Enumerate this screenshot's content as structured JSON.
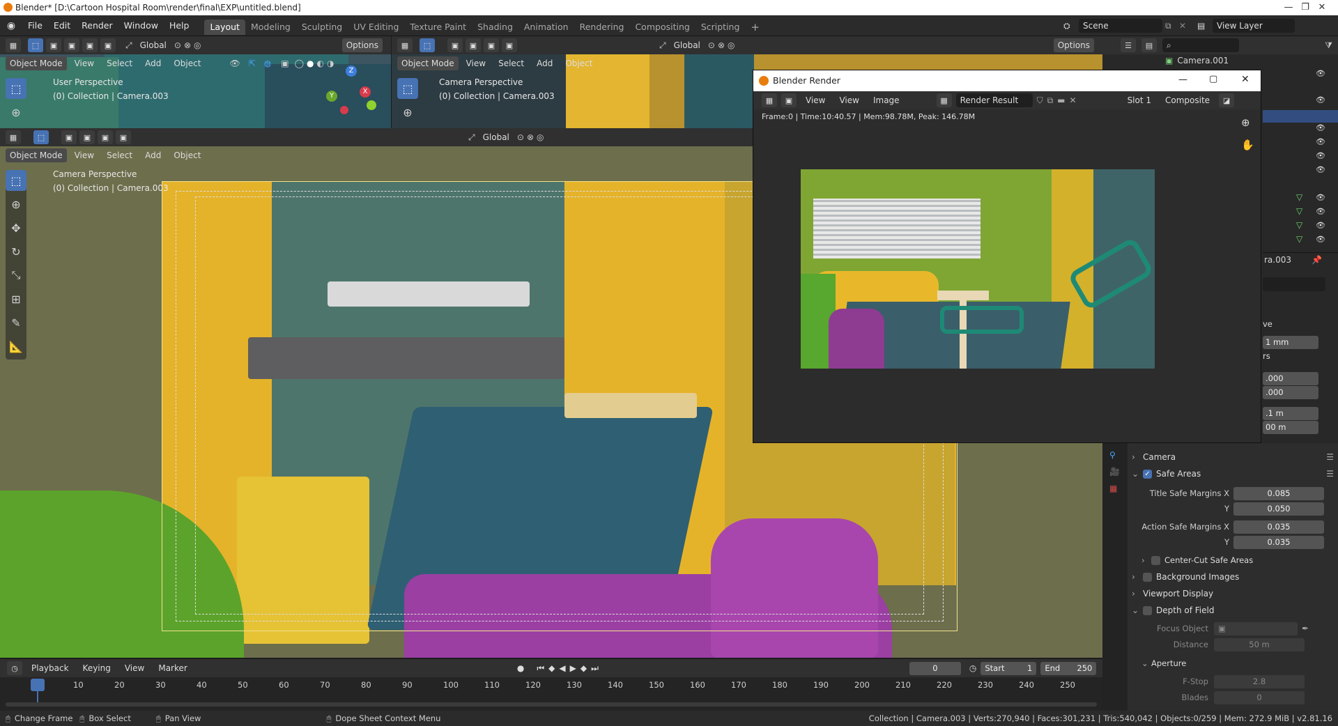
{
  "window": {
    "title": "Blender* [D:\\Cartoon Hospital Room\\render\\final\\EXP\\untitled.blend]",
    "minimize": "—",
    "maximize": "❐",
    "close": "✕"
  },
  "menu": [
    "File",
    "Edit",
    "Render",
    "Window",
    "Help"
  ],
  "workspaces": [
    "Layout",
    "Modeling",
    "Sculpting",
    "UV Editing",
    "Texture Paint",
    "Shading",
    "Animation",
    "Rendering",
    "Compositing",
    "Scripting"
  ],
  "workspace_add": "+",
  "scene": {
    "name": "Scene",
    "view_layer": "View Layer"
  },
  "toolbar": {
    "transform_orientation": "Global",
    "options": "Options"
  },
  "viewport_top_left": {
    "mode": "Object Mode",
    "menus": [
      "View",
      "Select",
      "Add",
      "Object"
    ],
    "perspective": "User Perspective",
    "collection": "(0) Collection | Camera.003",
    "gizmo": {
      "x": "X",
      "y": "Y",
      "z": "Z"
    }
  },
  "viewport_top_right": {
    "mode": "Object Mode",
    "menus": [
      "View",
      "Select",
      "Add",
      "Object"
    ],
    "perspective": "Camera Perspective",
    "collection": "(0) Collection | Camera.003"
  },
  "viewport_main": {
    "orientation": "Global",
    "mode": "Object Mode",
    "menus": [
      "View",
      "Select",
      "Add",
      "Object"
    ],
    "perspective": "Camera Perspective",
    "collection": "(0) Collection | Camera.003"
  },
  "render_window": {
    "title": "Blender Render",
    "menus": [
      "View",
      "View",
      "Image"
    ],
    "image_name": "Render Result",
    "slot": "Slot 1",
    "layer": "Composite",
    "stats": "Frame:0 | Time:10:40.57 | Mem:98.78M, Peak: 146.78M"
  },
  "outliner": {
    "selected": "Camera.001"
  },
  "properties": {
    "partial_name": "ra.003",
    "partial_values": [
      "ve",
      "1 mm",
      "rs",
      ".000",
      ".000",
      ".1 m",
      "00 m"
    ],
    "camera_label": "Camera",
    "safe_areas": {
      "label": "Safe Areas",
      "enabled": true
    },
    "title_safe_x_label": "Title Safe Margins X",
    "title_safe_x": "0.085",
    "title_safe_y_label": "Y",
    "title_safe_y": "0.050",
    "action_safe_x_label": "Action Safe Margins X",
    "action_safe_x": "0.035",
    "action_safe_y_label": "Y",
    "action_safe_y": "0.035",
    "center_cut": "Center-Cut Safe Areas",
    "background_images": "Background Images",
    "viewport_display": "Viewport Display",
    "depth_of_field": "Depth of Field",
    "focus_object_label": "Focus Object",
    "distance_label": "Distance",
    "distance": "50 m",
    "aperture": "Aperture",
    "fstop_label": "F-Stop",
    "fstop": "2.8",
    "blades_label": "Blades",
    "blades": "0"
  },
  "timeline": {
    "menus": [
      "Playback",
      "Keying",
      "View",
      "Marker"
    ],
    "current_frame": "0",
    "start_label": "Start",
    "start": "1",
    "end_label": "End",
    "end": "250",
    "ticks": [
      "0",
      "10",
      "20",
      "30",
      "40",
      "50",
      "60",
      "70",
      "80",
      "90",
      "100",
      "110",
      "120",
      "130",
      "140",
      "150",
      "160",
      "170",
      "180",
      "190",
      "200",
      "210",
      "220",
      "230",
      "240",
      "250"
    ]
  },
  "statusbar": {
    "change_frame": "Change Frame",
    "box_select": "Box Select",
    "pan_view": "Pan View",
    "context_menu": "Dope Sheet Context Menu",
    "stats": "Collection | Camera.003 | Verts:270,940 | Faces:301,231 | Tris:540,042 | Objects:0/259 | Mem: 272.9 MiB | v2.81.16"
  },
  "colors": {
    "accent": "#4772b3",
    "blender_orange": "#e87d0d",
    "wall_yellow": "#e5b32a",
    "bed_teal": "#2f5f73",
    "bed_purple": "#9b3fa3",
    "floor_gray": "#5c6163"
  }
}
